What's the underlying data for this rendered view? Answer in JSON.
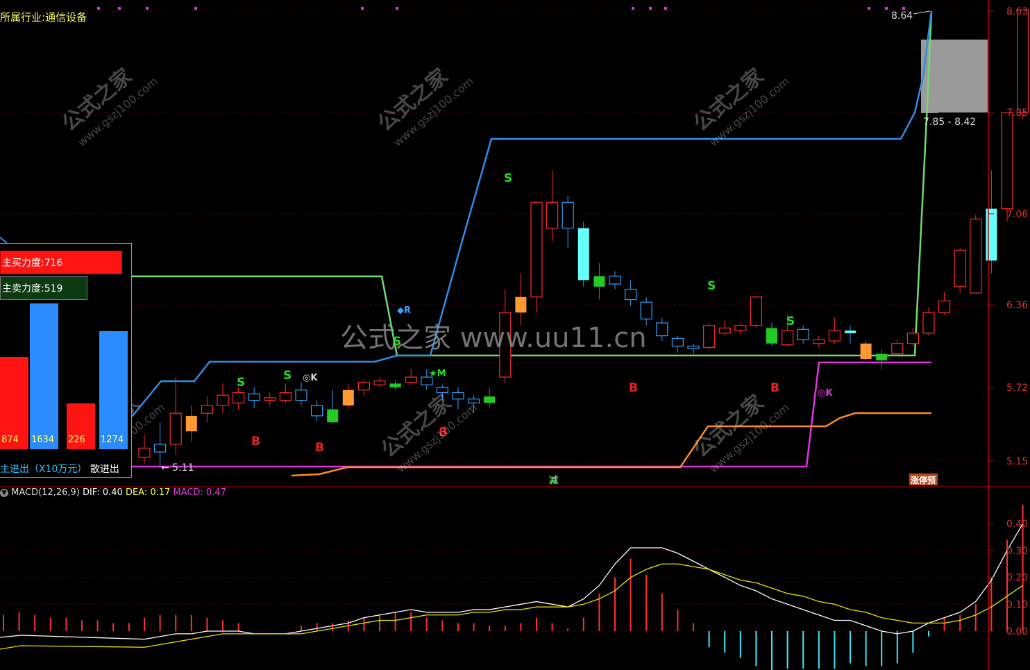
{
  "header": {
    "industry_label": "所属行业:",
    "industry_value": "通信设备"
  },
  "watermarks": {
    "brand": "公式之家",
    "site": "www.gszj100.com",
    "center": "公式之家 www.uu11.cn"
  },
  "colors": {
    "bg": "#000000",
    "up_candle": "#ff2a2a",
    "down_candle": "#33a0ff",
    "green_line": "#6fdc6f",
    "blue_line": "#2e8ee6",
    "magenta_line": "#e034e0",
    "orange_line": "#ff8c1a",
    "dif": "#ffffff",
    "dea": "#e6e600",
    "macd_pos": "#ff3030",
    "macd_neg": "#3fe6ff",
    "axis": "#c00000"
  },
  "price_axis": {
    "ticks": [
      "8.63",
      "7.85",
      "7.06",
      "6.36",
      "5.72",
      "5.15"
    ]
  },
  "macd_axis": {
    "ticks": [
      "0.40",
      "0.30",
      "0.20",
      "0.10",
      "0.00"
    ]
  },
  "annotations": {
    "high_label": "8.64",
    "low_label": "5.11",
    "range_label": "7.85 - 8.42",
    "jian": "减",
    "zhangting": "涨停预"
  },
  "panel": {
    "buy_label": "主买力度:716",
    "sell_label": "主卖力度:519",
    "columns": [
      {
        "value": "874",
        "color": "#ff1414"
      },
      {
        "value": "1634",
        "color": "#2a8cff"
      },
      {
        "value": "226",
        "color": "#ff1414"
      },
      {
        "value": "1274",
        "color": "#2a8cff"
      }
    ],
    "flow_label": "主进出（X10万元）",
    "flow_label2": "散进出"
  },
  "macd_header": {
    "name": "MACD(12,26,9)",
    "dif_label": "DIF: 0.40",
    "dea_label": "DEA: 0.17",
    "macd_label": "MACD: 0.47"
  },
  "chart_data": {
    "type": "candlestick",
    "y_range": [
      5.11,
      8.64
    ],
    "candles": [
      {
        "o": 5.18,
        "c": 5.25,
        "h": 5.36,
        "l": 5.13
      },
      {
        "o": 5.28,
        "c": 5.22,
        "h": 5.45,
        "l": 5.11
      },
      {
        "o": 5.28,
        "c": 5.52,
        "h": 5.8,
        "l": 5.2
      },
      {
        "o": 5.38,
        "c": 5.5,
        "h": 5.58,
        "l": 5.3
      },
      {
        "o": 5.52,
        "c": 5.58,
        "h": 5.65,
        "l": 5.45
      },
      {
        "o": 5.58,
        "c": 5.66,
        "h": 5.75,
        "l": 5.52
      },
      {
        "o": 5.6,
        "c": 5.68,
        "h": 5.72,
        "l": 5.55
      },
      {
        "o": 5.67,
        "c": 5.62,
        "h": 5.72,
        "l": 5.56
      },
      {
        "o": 5.62,
        "c": 5.64,
        "h": 5.68,
        "l": 5.58
      },
      {
        "o": 5.62,
        "c": 5.68,
        "h": 5.75,
        "l": 5.6
      },
      {
        "o": 5.7,
        "c": 5.62,
        "h": 5.76,
        "l": 5.58
      },
      {
        "o": 5.58,
        "c": 5.5,
        "h": 5.62,
        "l": 5.46
      },
      {
        "o": 5.55,
        "c": 5.45,
        "h": 5.7,
        "l": 5.44
      },
      {
        "o": 5.58,
        "c": 5.7,
        "h": 5.75,
        "l": 5.55
      },
      {
        "o": 5.7,
        "c": 5.76,
        "h": 5.78,
        "l": 5.65
      },
      {
        "o": 5.74,
        "c": 5.77,
        "h": 5.8,
        "l": 5.72
      },
      {
        "o": 5.72,
        "c": 5.75,
        "h": 5.78,
        "l": 5.7
      },
      {
        "o": 5.76,
        "c": 5.8,
        "h": 5.86,
        "l": 5.74
      },
      {
        "o": 5.8,
        "c": 5.74,
        "h": 5.86,
        "l": 5.7
      },
      {
        "o": 5.72,
        "c": 5.68,
        "h": 5.74,
        "l": 5.62
      },
      {
        "o": 5.68,
        "c": 5.63,
        "h": 5.72,
        "l": 5.55
      },
      {
        "o": 5.63,
        "c": 5.6,
        "h": 5.66,
        "l": 5.52
      },
      {
        "o": 5.6,
        "c": 5.65,
        "h": 5.72,
        "l": 5.56
      },
      {
        "o": 5.8,
        "c": 6.3,
        "h": 6.48,
        "l": 5.75
      },
      {
        "o": 6.3,
        "c": 6.42,
        "h": 6.6,
        "l": 6.2
      },
      {
        "o": 6.42,
        "c": 7.15,
        "h": 7.15,
        "l": 6.3
      },
      {
        "o": 6.95,
        "c": 7.15,
        "h": 7.4,
        "l": 6.85
      },
      {
        "o": 7.15,
        "c": 6.95,
        "h": 7.2,
        "l": 6.8
      },
      {
        "o": 6.95,
        "c": 6.55,
        "h": 7.0,
        "l": 6.5
      },
      {
        "o": 6.5,
        "c": 6.58,
        "h": 6.68,
        "l": 6.4
      },
      {
        "o": 6.58,
        "c": 6.52,
        "h": 6.62,
        "l": 6.48
      },
      {
        "o": 6.48,
        "c": 6.4,
        "h": 6.55,
        "l": 6.35
      },
      {
        "o": 6.38,
        "c": 6.25,
        "h": 6.42,
        "l": 6.2
      },
      {
        "o": 6.22,
        "c": 6.12,
        "h": 6.26,
        "l": 6.08
      },
      {
        "o": 6.1,
        "c": 6.04,
        "h": 6.12,
        "l": 5.99
      },
      {
        "o": 6.04,
        "c": 6.02,
        "h": 6.06,
        "l": 5.98
      },
      {
        "o": 6.03,
        "c": 6.2,
        "h": 6.22,
        "l": 6.01
      },
      {
        "o": 6.14,
        "c": 6.18,
        "h": 6.24,
        "l": 6.12
      },
      {
        "o": 6.16,
        "c": 6.2,
        "h": 6.22,
        "l": 6.13
      },
      {
        "o": 6.2,
        "c": 6.42,
        "h": 6.43,
        "l": 6.18
      },
      {
        "o": 6.18,
        "c": 6.06,
        "h": 6.22,
        "l": 6.04
      },
      {
        "o": 6.05,
        "c": 6.16,
        "h": 6.28,
        "l": 6.04
      },
      {
        "o": 6.17,
        "c": 6.09,
        "h": 6.2,
        "l": 6.06
      },
      {
        "o": 6.06,
        "c": 6.09,
        "h": 6.12,
        "l": 6.03
      },
      {
        "o": 6.08,
        "c": 6.16,
        "h": 6.26,
        "l": 6.06
      },
      {
        "o": 6.16,
        "c": 6.14,
        "h": 6.2,
        "l": 6.06
      },
      {
        "o": 6.06,
        "c": 5.94,
        "h": 6.08,
        "l": 5.93
      },
      {
        "o": 5.93,
        "c": 5.98,
        "h": 6.02,
        "l": 5.86
      },
      {
        "o": 5.98,
        "c": 6.06,
        "h": 6.09,
        "l": 5.96
      },
      {
        "o": 6.06,
        "c": 6.14,
        "h": 6.18,
        "l": 6.04
      },
      {
        "o": 6.14,
        "c": 6.3,
        "h": 6.34,
        "l": 6.12
      },
      {
        "o": 6.3,
        "c": 6.39,
        "h": 6.46,
        "l": 6.28
      },
      {
        "o": 6.5,
        "c": 6.78,
        "h": 6.8,
        "l": 6.45
      },
      {
        "o": 6.45,
        "c": 7.02,
        "h": 7.05,
        "l": 6.45
      },
      {
        "o": 6.7,
        "c": 7.1,
        "h": 7.4,
        "l": 6.6
      },
      {
        "o": 7.1,
        "c": 7.85,
        "h": 7.85,
        "l": 7.0
      },
      {
        "o": 7.85,
        "c": 8.64,
        "h": 8.64,
        "l": 7.8
      }
    ],
    "macd": {
      "dif": [
        -0.03,
        -0.02,
        -0.01,
        -0.01,
        0.0,
        0.0,
        0.0,
        -0.01,
        -0.01,
        -0.01,
        0.0,
        0.01,
        0.02,
        0.03,
        0.05,
        0.06,
        0.07,
        0.08,
        0.07,
        0.07,
        0.07,
        0.08,
        0.08,
        0.09,
        0.1,
        0.11,
        0.1,
        0.09,
        0.12,
        0.17,
        0.25,
        0.31,
        0.31,
        0.31,
        0.29,
        0.26,
        0.23,
        0.2,
        0.17,
        0.15,
        0.12,
        0.1,
        0.08,
        0.06,
        0.04,
        0.04,
        0.02,
        0.0,
        -0.01,
        0.0,
        0.03,
        0.05,
        0.07,
        0.11,
        0.19,
        0.3,
        0.4
      ],
      "dea": [
        -0.06,
        -0.05,
        -0.04,
        -0.03,
        -0.02,
        -0.01,
        -0.01,
        -0.01,
        -0.01,
        -0.01,
        -0.01,
        0.0,
        0.01,
        0.02,
        0.03,
        0.04,
        0.04,
        0.05,
        0.06,
        0.06,
        0.06,
        0.07,
        0.07,
        0.08,
        0.08,
        0.09,
        0.09,
        0.09,
        0.1,
        0.12,
        0.15,
        0.2,
        0.23,
        0.25,
        0.25,
        0.24,
        0.23,
        0.21,
        0.19,
        0.18,
        0.16,
        0.14,
        0.13,
        0.11,
        0.1,
        0.08,
        0.07,
        0.05,
        0.04,
        0.03,
        0.03,
        0.03,
        0.04,
        0.06,
        0.09,
        0.13,
        0.17
      ],
      "hist": [
        0.05,
        0.06,
        0.06,
        0.06,
        0.05,
        0.04,
        0.03,
        0.0,
        0.0,
        0.0,
        0.02,
        0.03,
        0.03,
        0.04,
        0.05,
        0.06,
        0.07,
        0.07,
        0.05,
        0.04,
        0.03,
        0.03,
        0.02,
        0.02,
        0.03,
        0.05,
        0.03,
        0.01,
        0.05,
        0.14,
        0.2,
        0.27,
        0.21,
        0.14,
        0.08,
        0.03,
        -0.06,
        -0.08,
        -0.1,
        -0.13,
        -0.15,
        -0.14,
        -0.14,
        -0.14,
        -0.14,
        -0.12,
        -0.13,
        -0.13,
        -0.12,
        -0.08,
        -0.02,
        0.05,
        0.06,
        0.1,
        0.2,
        0.34,
        0.47
      ]
    }
  }
}
